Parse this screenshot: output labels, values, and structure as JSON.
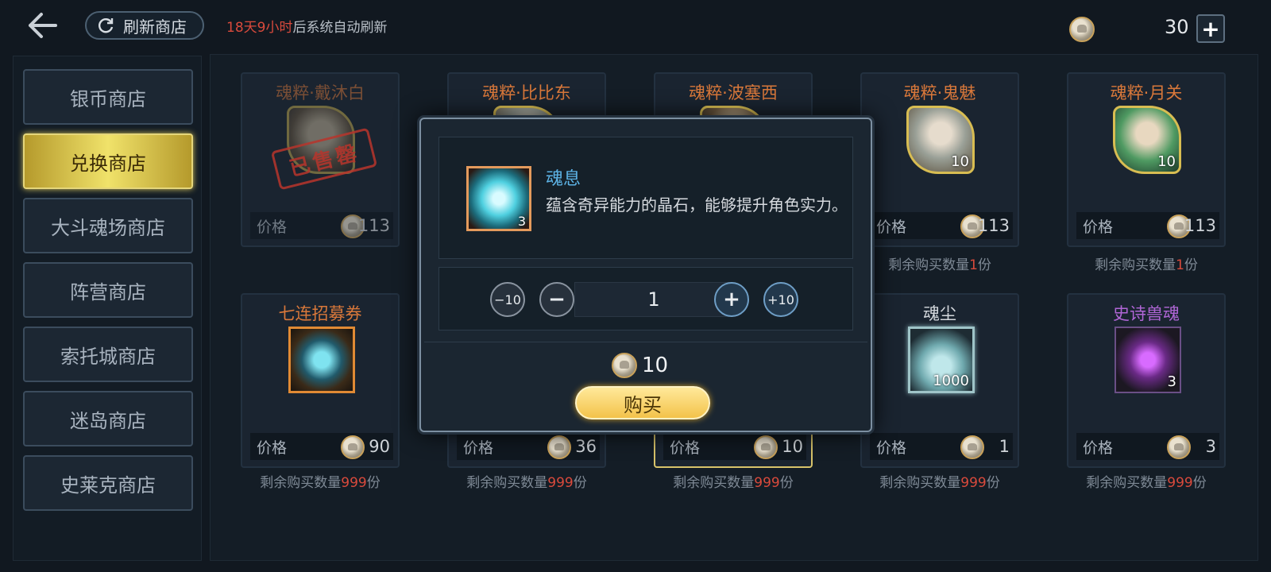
{
  "topbar": {
    "refresh_label": "刷新商店",
    "refresh_time": "18天9小时",
    "refresh_suffix": "后系统自动刷新",
    "currency_amount": "30"
  },
  "sidebar": {
    "items": [
      {
        "label": "银币商店"
      },
      {
        "label": "兑换商店",
        "active": true
      },
      {
        "label": "大斗魂场商店"
      },
      {
        "label": "阵营商店"
      },
      {
        "label": "索托城商店"
      },
      {
        "label": "迷岛商店"
      },
      {
        "label": "史莱克商店"
      }
    ]
  },
  "shop": {
    "price_label": "价格",
    "remain_prefix": "剩余购买数量",
    "remain_suffix": "份",
    "stamp_text": "已售罄",
    "items": [
      {
        "name": "魂粹·戴沐白",
        "price": "113",
        "qty": "",
        "remain": "",
        "sold_out": true
      },
      {
        "name": "魂粹·比比东",
        "price": "",
        "qty": "",
        "remain": ""
      },
      {
        "name": "魂粹·波塞西",
        "price": "",
        "qty": "",
        "remain": ""
      },
      {
        "name": "魂粹·鬼魅",
        "price": "113",
        "qty": "10",
        "remain": "1"
      },
      {
        "name": "魂粹·月关",
        "price": "113",
        "qty": "10",
        "remain": "1"
      },
      {
        "name": "七连招募券",
        "price": "90",
        "qty": "",
        "remain": "999"
      },
      {
        "name": "",
        "price": "36",
        "qty": "",
        "remain": "999"
      },
      {
        "name": "",
        "price": "10",
        "qty": "",
        "remain": "999",
        "selected": true
      },
      {
        "name": "魂尘",
        "price": "1",
        "qty": "1000",
        "remain": "999"
      },
      {
        "name": "史诗兽魂",
        "price": "3",
        "qty": "3",
        "remain": "999"
      }
    ]
  },
  "dialog": {
    "item_name": "魂息",
    "item_desc": "蕴含奇异能力的晶石，能够提升角色实力。",
    "item_qty": "3",
    "minus10": "−10",
    "minus1": "−",
    "quantity": "1",
    "plus1": "+",
    "plus10": "+10",
    "cost": "10",
    "buy_label": "购买"
  },
  "colors": {
    "accent_red": "#d94a3c",
    "name_orange": "#d9783a",
    "name_purple": "#b066d6",
    "dialog_title_blue": "#5db3e6",
    "buy_gold": "#f3c34a"
  }
}
